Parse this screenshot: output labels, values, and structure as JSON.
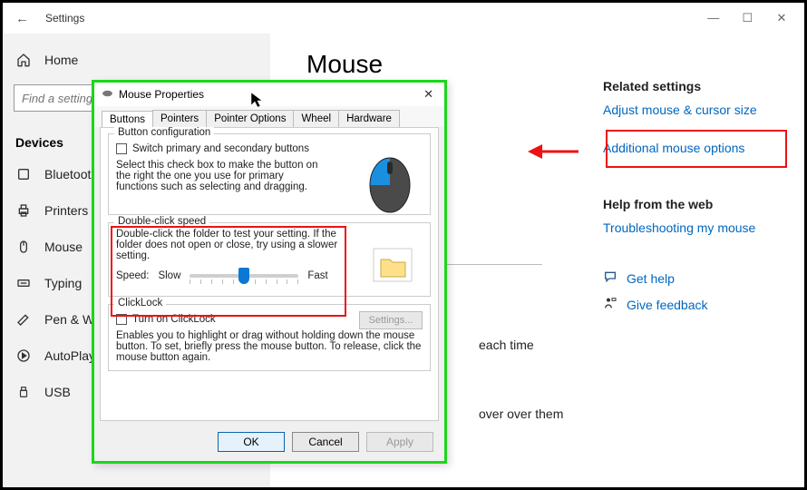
{
  "titlebar": {
    "title": "Settings"
  },
  "sidebar": {
    "home": "Home",
    "search_placeholder": "Find a setting",
    "category": "Devices",
    "items": [
      {
        "icon": "bluetooth",
        "label": "Bluetooth"
      },
      {
        "icon": "printer",
        "label": "Printers &"
      },
      {
        "icon": "mouse",
        "label": "Mouse"
      },
      {
        "icon": "keyboard",
        "label": "Typing"
      },
      {
        "icon": "pen",
        "label": "Pen & Wi"
      },
      {
        "icon": "autoplay",
        "label": "AutoPlay"
      },
      {
        "icon": "usb",
        "label": "USB"
      }
    ]
  },
  "main": {
    "title": "Mouse",
    "line1": "each time",
    "line2": "over over them"
  },
  "right": {
    "related_head": "Related settings",
    "link1": "Adjust mouse & cursor size",
    "link2": "Additional mouse options",
    "help_head": "Help from the web",
    "link3": "Troubleshooting my mouse",
    "get_help": "Get help",
    "give_feedback": "Give feedback"
  },
  "dialog": {
    "title": "Mouse Properties",
    "tabs": [
      "Buttons",
      "Pointers",
      "Pointer Options",
      "Wheel",
      "Hardware"
    ],
    "group1": {
      "title": "Button configuration",
      "chk": "Switch primary and secondary buttons",
      "desc": "Select this check box to make the button on the right the one you use for primary functions such as selecting and dragging."
    },
    "group2": {
      "title": "Double-click speed",
      "desc": "Double-click the folder to test your setting. If the folder does not open or close, try using a slower setting.",
      "speed_label": "Speed:",
      "slow": "Slow",
      "fast": "Fast"
    },
    "group3": {
      "title": "ClickLock",
      "chk": "Turn on ClickLock",
      "settings_btn": "Settings...",
      "desc": "Enables you to highlight or drag without holding down the mouse button. To set, briefly press the mouse button. To release, click the mouse button again."
    },
    "ok": "OK",
    "cancel": "Cancel",
    "apply": "Apply"
  }
}
